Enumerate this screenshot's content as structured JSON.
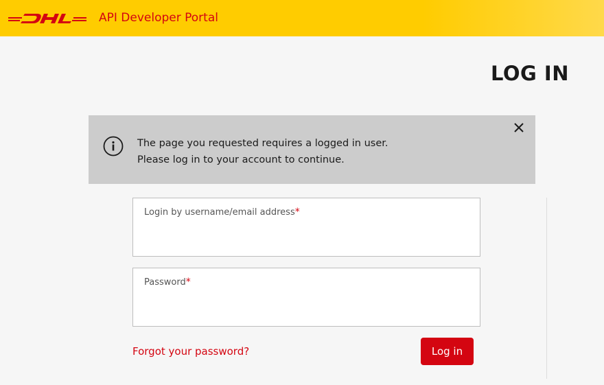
{
  "header": {
    "logo": "DHL",
    "title": "API Developer Portal",
    "brand_color": "#d40511",
    "bar_color": "#ffcc00"
  },
  "page": {
    "heading": "LOG IN"
  },
  "notice": {
    "icon": "info-icon",
    "line1": "The page you requested requires a logged in user.",
    "line2": "Please log in to your account to continue.",
    "close_icon": "close-icon"
  },
  "form": {
    "username": {
      "label": "Login by username/email address",
      "required_mark": "*",
      "value": ""
    },
    "password": {
      "label": "Password",
      "required_mark": "*",
      "value": ""
    },
    "forgot_link": "Forgot your password?",
    "submit_label": "Log in"
  }
}
